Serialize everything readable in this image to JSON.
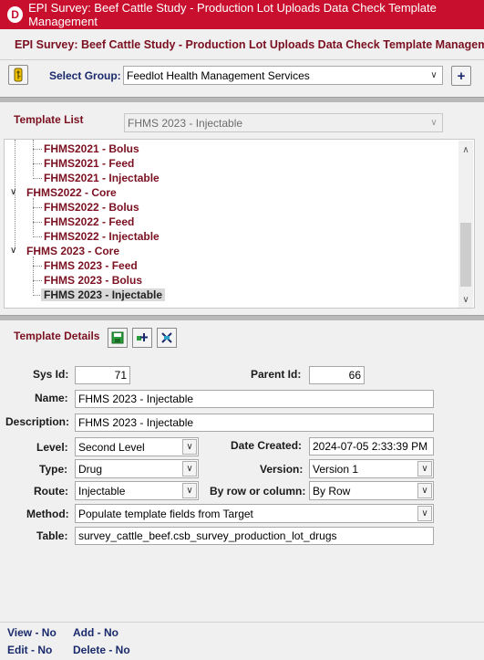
{
  "window": {
    "app_icon_letter": "D",
    "title": "EPI Survey: Beef Cattle Study - Production Lot Uploads Data Check Template Management"
  },
  "header": {
    "title": "EPI Survey: Beef Cattle Study - Production Lot Uploads Data Check Template Management"
  },
  "group": {
    "label": "Select Group:",
    "selected": "Feedlot Health Management Services",
    "add_symbol": "+"
  },
  "template_list": {
    "label": "Template List",
    "selected": "FHMS 2023 - Injectable",
    "tree": [
      {
        "label": "FHMS2021 - Bolus",
        "level": 1
      },
      {
        "label": "FHMS2021 - Feed",
        "level": 1
      },
      {
        "label": "FHMS2021 - Injectable",
        "level": 1
      },
      {
        "label": "FHMS2022 - Core",
        "level": 0
      },
      {
        "label": "FHMS2022 - Bolus",
        "level": 1
      },
      {
        "label": "FHMS2022 - Feed",
        "level": 1
      },
      {
        "label": "FHMS2022 - Injectable",
        "level": 1
      },
      {
        "label": "FHMS 2023 - Core",
        "level": 0
      },
      {
        "label": "FHMS 2023 - Feed",
        "level": 1
      },
      {
        "label": "FHMS 2023 - Bolus",
        "level": 1
      },
      {
        "label": "FHMS 2023 - Injectable",
        "level": 1,
        "selected": true
      }
    ]
  },
  "details": {
    "label": "Template Details",
    "sys_id_label": "Sys Id:",
    "sys_id": "71",
    "parent_id_label": "Parent Id:",
    "parent_id": "66",
    "name_label": "Name:",
    "name": "FHMS 2023 - Injectable",
    "description_label": "Description:",
    "description": "FHMS 2023 - Injectable",
    "level_label": "Level:",
    "level": "Second Level",
    "date_created_label": "Date Created:",
    "date_created": "2024-07-05 2:33:39 PM",
    "type_label": "Type:",
    "type": "Drug",
    "version_label": "Version:",
    "version": "Version 1",
    "route_label": "Route:",
    "route": "Injectable",
    "by_row_label": "By row or column:",
    "by_row": "By Row",
    "method_label": "Method:",
    "method": "Populate template fields from Target",
    "table_label": "Table:",
    "table": "survey_cattle_beef.csb_survey_production_lot_drugs"
  },
  "footer": {
    "view": "View - No",
    "add": "Add - No",
    "edit": "Edit - No",
    "delete": "Delete - No"
  },
  "colors": {
    "titlebar": "#c8102e",
    "maroon": "#7a1020",
    "navy": "#1a2a6c"
  }
}
